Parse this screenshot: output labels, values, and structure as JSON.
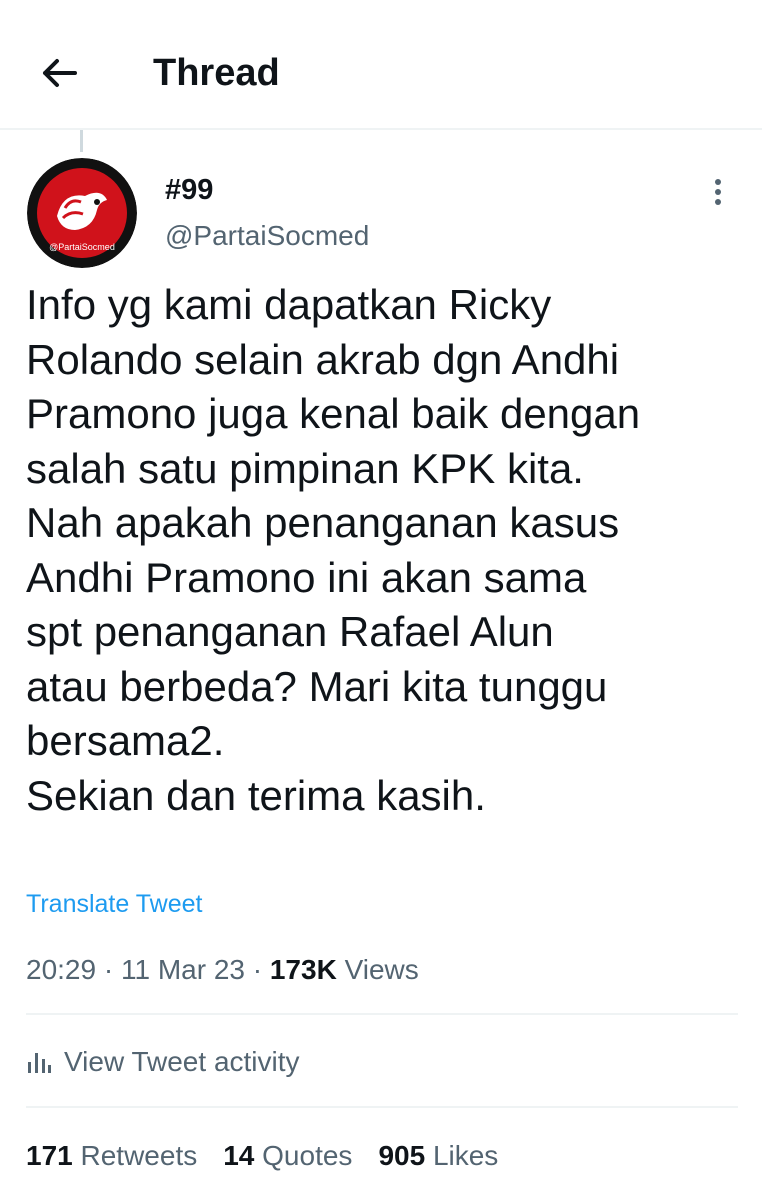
{
  "header": {
    "title": "Thread",
    "back_icon": "arrow-left-icon"
  },
  "tweet": {
    "author": {
      "name": "#99",
      "handle": "@PartaiSocmed",
      "avatar_label": "@PartaiSocmed"
    },
    "text": "Info yg kami dapatkan Ricky\nRolando selain akrab dgn Andhi\nPramono juga kenal baik dengan\nsalah satu pimpinan KPK kita.\nNah apakah penanganan kasus\nAndhi Pramono ini akan sama\nspt penanganan Rafael Alun\natau berbeda? Mari kita tunggu\nbersama2.\nSekian dan terima kasih.",
    "translate_label": "Translate Tweet",
    "time": "20:29",
    "date": "11 Mar 23",
    "separator": "·",
    "views_count": "173K",
    "views_label": "Views",
    "activity_label": "View Tweet activity",
    "stats": {
      "retweets_count": "171",
      "retweets_label": "Retweets",
      "quotes_count": "14",
      "quotes_label": "Quotes",
      "likes_count": "905",
      "likes_label": "Likes"
    }
  },
  "colors": {
    "accent": "#1d9bf0",
    "secondary_text": "#536471",
    "primary_text": "#0f1419",
    "divider": "#eff3f4"
  }
}
